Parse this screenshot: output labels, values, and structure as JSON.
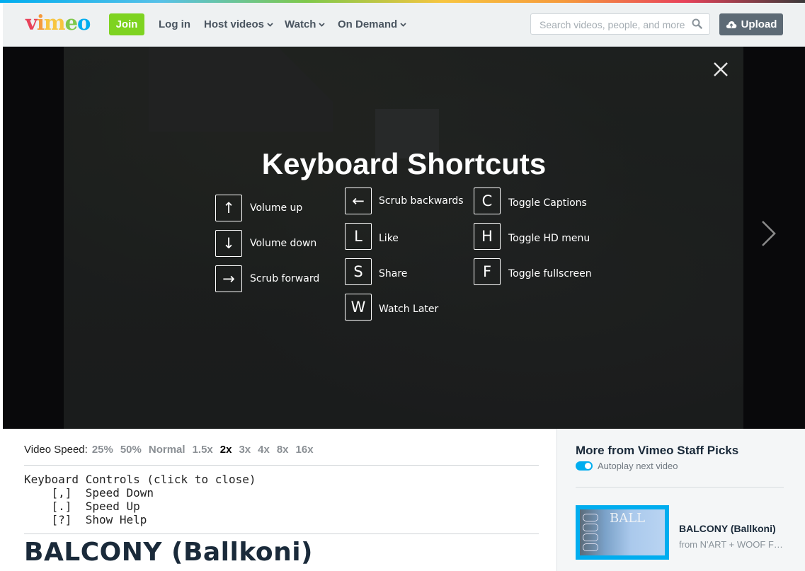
{
  "header": {
    "logo": "vimeo",
    "join_label": "Join",
    "login_label": "Log in",
    "host_videos_label": "Host videos",
    "watch_label": "Watch",
    "on_demand_label": "On Demand",
    "search_placeholder": "Search videos, people, and more",
    "upload_label": "Upload"
  },
  "overlay": {
    "title": "Keyboard Shortcuts",
    "shortcuts": [
      {
        "key": "↑",
        "label": "Volume up"
      },
      {
        "key": "↓",
        "label": "Volume down"
      },
      {
        "key": "→",
        "label": "Scrub forward"
      },
      {
        "key": "←",
        "label": "Scrub backwards"
      },
      {
        "key": "L",
        "label": "Like"
      },
      {
        "key": "S",
        "label": "Share"
      },
      {
        "key": "W",
        "label": "Watch Later"
      },
      {
        "key": "C",
        "label": "Toggle Captions"
      },
      {
        "key": "H",
        "label": "Toggle HD menu"
      },
      {
        "key": "F",
        "label": "Toggle fullscreen"
      }
    ]
  },
  "speed": {
    "label": "Video Speed:",
    "options": [
      "25%",
      "50%",
      "Normal",
      "1.5x",
      "2x",
      "3x",
      "4x",
      "8x",
      "16x"
    ],
    "active": "2x"
  },
  "keyboard_controls": {
    "heading": "Keyboard Controls (click to close)",
    "lines": [
      "    [,]  Speed Down",
      "    [.]  Speed Up",
      "    [?]  Show Help"
    ]
  },
  "video": {
    "title": "BALCONY (Ballkoni)"
  },
  "sidebar": {
    "title": "More from Vimeo Staff Picks",
    "autoplay_label": "Autoplay next video",
    "items": [
      {
        "title": "BALCONY (Ballkoni)",
        "from": "from N'ART + WOOF F…",
        "thumb_text": "BALL"
      }
    ]
  },
  "colors": {
    "join": "#7ed321",
    "upload": "#5d6a75",
    "accent": "#00adef"
  }
}
